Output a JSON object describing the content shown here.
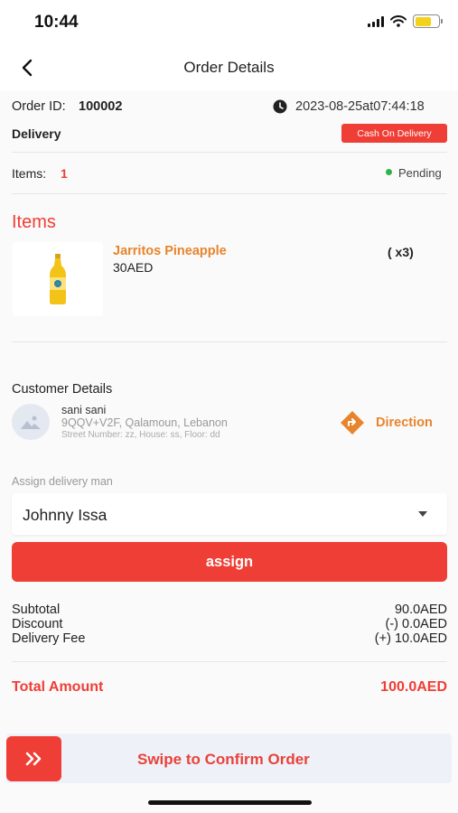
{
  "status_bar": {
    "time": "10:44"
  },
  "nav": {
    "title": "Order Details"
  },
  "order": {
    "id_label": "Order ID:",
    "id_value": "100002",
    "timestamp": "2023-08-25at07:44:18",
    "type": "Delivery",
    "payment_badge": "Cash On Delivery",
    "items_label": "Items:",
    "items_count": "1",
    "status": "Pending"
  },
  "items_section": {
    "heading": "Items",
    "products": [
      {
        "name": "Jarritos Pineapple",
        "price": "30AED",
        "quantity": "( x3)"
      }
    ]
  },
  "customer": {
    "heading": "Customer Details",
    "name": "sani sani",
    "address": "9QQV+V2F, Qalamoun, Lebanon",
    "details": "Street Number: zz, House: ss, Floor: dd",
    "direction_label": "Direction"
  },
  "assign": {
    "label": "Assign delivery man",
    "selected": "Johnny Issa",
    "button_label": "assign"
  },
  "summary": {
    "subtotal_label": "Subtotal",
    "subtotal_value": "90.0AED",
    "discount_label": "Discount",
    "discount_value": "(-) 0.0AED",
    "delivery_label": "Delivery Fee",
    "delivery_value": "(+) 10.0AED",
    "total_label": "Total Amount",
    "total_value": "100.0AED"
  },
  "swipe": {
    "label": "Swipe to Confirm Order"
  },
  "colors": {
    "accent": "#ef3e36",
    "highlight": "#e8842c",
    "success": "#2fb24c"
  },
  "icons": [
    "back-arrow-icon",
    "clock-icon",
    "status-dot-icon",
    "image-placeholder-icon",
    "direction-icon",
    "dropdown-caret-icon",
    "double-chevron-right-icon"
  ]
}
